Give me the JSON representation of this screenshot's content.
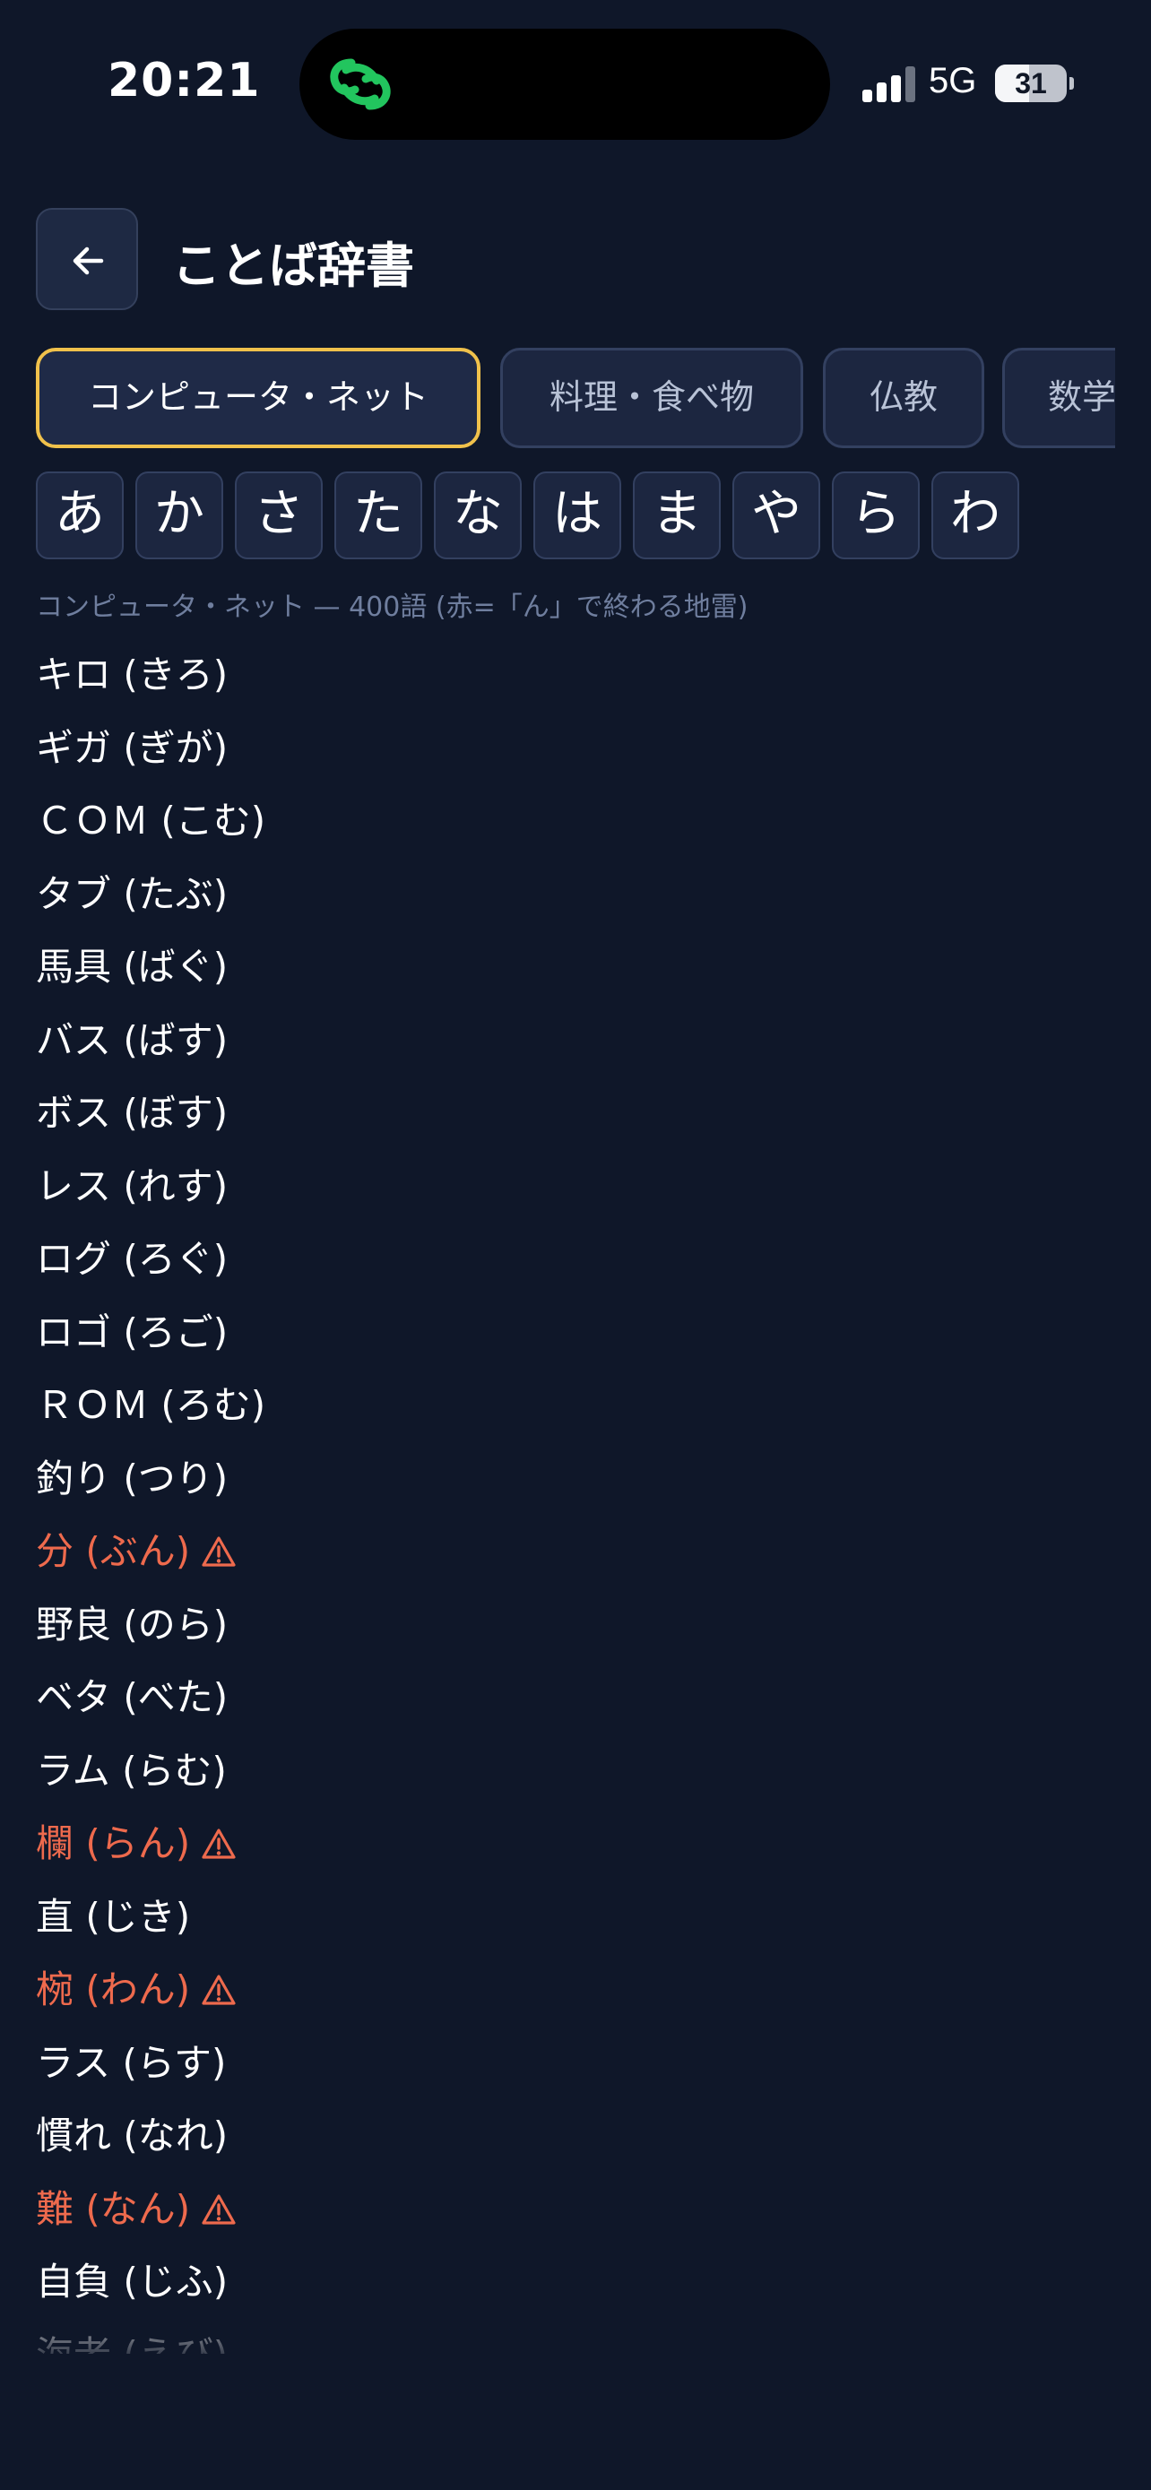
{
  "status_bar": {
    "time": "20:21",
    "network": "5G",
    "battery": "31",
    "battery_level": 0.31,
    "island_icon": "green-chain-link-icon",
    "island_icon_color": "#22c55e"
  },
  "header": {
    "title": "ことば辞書",
    "back_icon": "arrow-left-icon"
  },
  "tabs": [
    {
      "label": "コンピュータ・ネット",
      "active": true
    },
    {
      "label": "料理・食べ物",
      "active": false
    },
    {
      "label": "仏教",
      "active": false
    },
    {
      "label": "数学",
      "active": false
    }
  ],
  "kana": [
    "あ",
    "か",
    "さ",
    "た",
    "な",
    "は",
    "ま",
    "や",
    "ら",
    "わ"
  ],
  "summary": "コンピュータ・ネット — 400語 (赤=「ん」で終わる地雷)",
  "words": [
    {
      "text": "キロ (きろ)",
      "mine": false
    },
    {
      "text": "ギガ (ぎが)",
      "mine": false
    },
    {
      "text": "ＣＯＭ (こむ)",
      "mine": false
    },
    {
      "text": "タブ (たぶ)",
      "mine": false
    },
    {
      "text": "馬具 (ばぐ)",
      "mine": false
    },
    {
      "text": "バス (ばす)",
      "mine": false
    },
    {
      "text": "ボス (ぼす)",
      "mine": false
    },
    {
      "text": "レス (れす)",
      "mine": false
    },
    {
      "text": "ログ (ろぐ)",
      "mine": false
    },
    {
      "text": "ロゴ (ろご)",
      "mine": false
    },
    {
      "text": "ＲＯＭ (ろむ)",
      "mine": false
    },
    {
      "text": "釣り (つり)",
      "mine": false
    },
    {
      "text": "分 (ぶん)",
      "mine": true
    },
    {
      "text": "野良 (のら)",
      "mine": false
    },
    {
      "text": "ベタ (べた)",
      "mine": false
    },
    {
      "text": "ラム (らむ)",
      "mine": false
    },
    {
      "text": "欄 (らん)",
      "mine": true
    },
    {
      "text": "直 (じき)",
      "mine": false
    },
    {
      "text": "椀 (わん)",
      "mine": true
    },
    {
      "text": "ラス (らす)",
      "mine": false
    },
    {
      "text": "慣れ (なれ)",
      "mine": false
    },
    {
      "text": "難 (なん)",
      "mine": true
    },
    {
      "text": "自負 (じふ)",
      "mine": false
    },
    {
      "text": "海老 (えび)",
      "mine": false
    }
  ],
  "colors": {
    "background": "#0f1729",
    "active_tab_border": "#f0c14b",
    "mine_word": "#ee6a4d",
    "muted_text": "#6f7e9e"
  }
}
